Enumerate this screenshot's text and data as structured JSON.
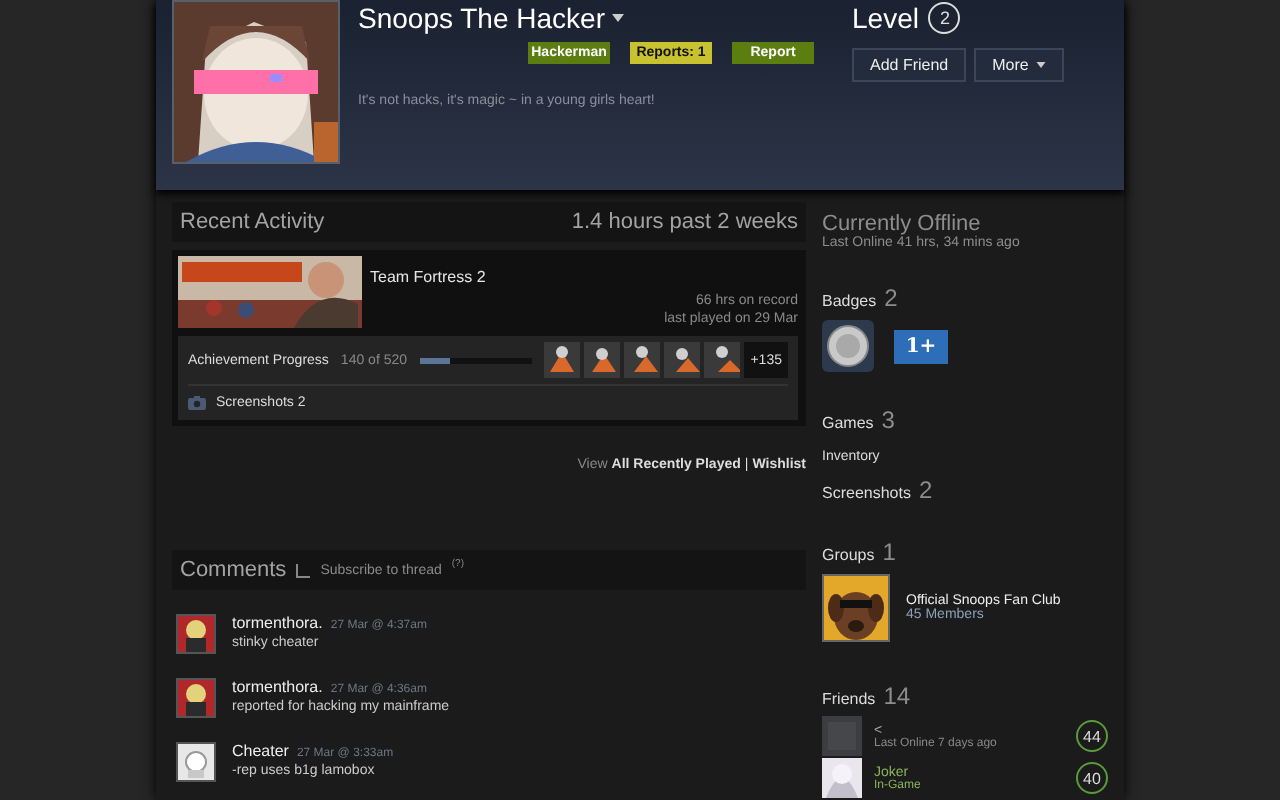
{
  "profile": {
    "name": "Snoops The Hacker",
    "tags": [
      {
        "label": "Hackerman",
        "color": "#5c7e10"
      },
      {
        "label": "Reports: 1",
        "color": "#c9c230"
      },
      {
        "label": "Report",
        "color": "#5c7e10"
      }
    ],
    "summary": "It's not hacks, it's magic ~ in a young girls heart!",
    "level_label": "Level",
    "level_value": "2",
    "actions": [
      {
        "label": "Add Friend",
        "dropdown": false
      },
      {
        "label": "More",
        "dropdown": true
      }
    ]
  },
  "recent_activity": {
    "title": "Recent Activity",
    "playtime": "1.4 hours past 2 weeks",
    "game": {
      "name": "Team Fortress 2",
      "hours": "66 hrs on record",
      "last_played": "last played on 29 Mar",
      "achievements": {
        "label": "Achievement Progress",
        "count": "140 of 520",
        "level": 0.27,
        "icons": [
          {
            "kind": "picture"
          },
          {
            "kind": "picture"
          },
          {
            "kind": "picture"
          },
          {
            "kind": "picture"
          },
          {
            "kind": "picture"
          }
        ],
        "more": "+135"
      },
      "screenshots": "Screenshots 2"
    },
    "footer": {
      "prefix": "View",
      "links": [
        "All Recently Played",
        "Wishlist"
      ],
      "separator": "|"
    }
  },
  "comments": {
    "title": "Comments",
    "subscribe": "Subscribe to thread",
    "subscribed": false,
    "note": "(?)",
    "items": [
      {
        "author": "tormenthora.",
        "time": "27 Mar @ 4:37am",
        "text": "stinky cheater"
      },
      {
        "author": "tormenthora.",
        "time": "27 Mar @ 4:36am",
        "text": "reported for hacking my mainframe"
      },
      {
        "author": "Cheater",
        "time": "27 Mar @ 3:33am",
        "text": "-rep uses b1g lamobox"
      }
    ]
  },
  "sidebar": {
    "status": "Currently Offline",
    "last_online": "Last Online 41 hrs, 34 mins ago",
    "badges": {
      "label": "Badges",
      "count": "2",
      "items": [
        {
          "kind": "coin"
        },
        {
          "kind": "years",
          "text": "1+"
        }
      ]
    },
    "games": {
      "label": "Games",
      "count": "3"
    },
    "inventory": "Inventory",
    "screenshots": {
      "label": "Screenshots",
      "count": "2"
    },
    "groups": {
      "label": "Groups",
      "count": "1",
      "items": [
        {
          "name": "Official Snoops Fan Club",
          "members": "45 Members"
        }
      ]
    },
    "friends": {
      "label": "Friends",
      "count": "14",
      "items": [
        {
          "name": "<",
          "status": "Last Online 7 days ago",
          "steam_level": "44",
          "in_game": false
        },
        {
          "name": "Joker",
          "status": "In-Game",
          "steam_level": "40",
          "in_game": true
        }
      ]
    }
  }
}
